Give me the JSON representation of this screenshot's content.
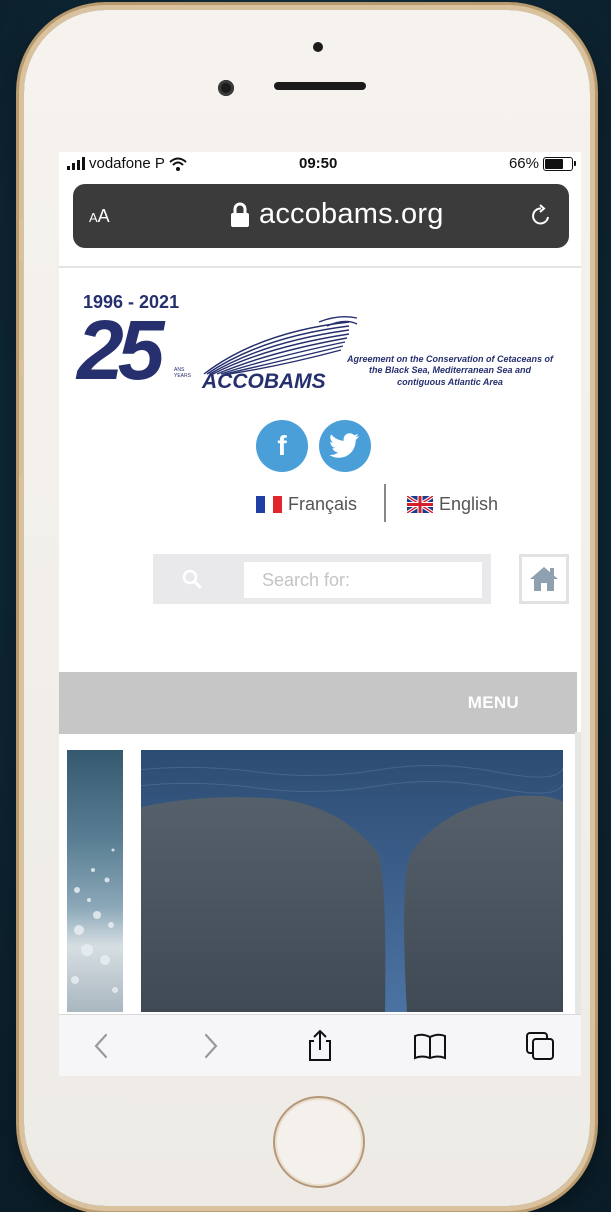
{
  "status_bar": {
    "carrier": "vodafone P",
    "time": "09:50",
    "battery": "66%",
    "battery_level": 0.66
  },
  "browser": {
    "text_size_label": "AA",
    "url": "accobams.org",
    "icons": [
      "lock-icon",
      "reload-icon",
      "back-icon",
      "forward-icon",
      "share-icon",
      "bookmarks-icon",
      "tabs-icon"
    ]
  },
  "site": {
    "logo": {
      "years": "1996 - 2021",
      "anniversary": "25",
      "anniversary_small": "ANS\nYEARS",
      "name": "ACCOBAMS",
      "tagline": "Agreement on the Conservation of Cetaceans of the Black Sea, Mediterranean Sea and contiguous Atlantic Area"
    },
    "social": [
      {
        "icon": "facebook-icon",
        "glyph": "f"
      },
      {
        "icon": "twitter-icon",
        "glyph": ""
      }
    ],
    "languages": [
      {
        "label": "Français",
        "flag": "flag-france-icon"
      },
      {
        "label": "English",
        "flag": "flag-uk-icon"
      }
    ],
    "search": {
      "placeholder": "Search for:"
    },
    "menu_label": "MENU",
    "colors": {
      "brand": "#26306e",
      "social": "#4b9fd9",
      "menu_bar": "#c6c6c6"
    }
  }
}
